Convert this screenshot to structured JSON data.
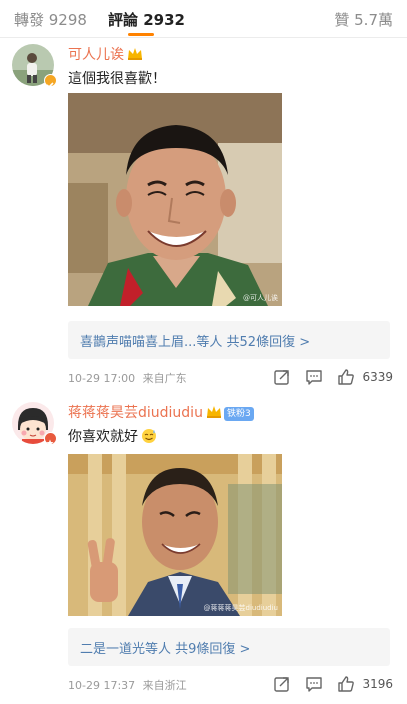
{
  "tabs": {
    "repost": "轉發 9298",
    "comments": "評論 2932",
    "likes": "贊 5.7萬"
  },
  "comments": [
    {
      "username": "可人儿诶",
      "text": "這個我很喜歡！",
      "watermark": "@可人儿诶",
      "replies": "喜鵲声喵喵喜上眉...等人 共52條回復 >",
      "time": "10-29 17:00",
      "location": "来自广东",
      "like_count": "6339"
    },
    {
      "username": "蒋蒋蒋昊芸diudiudiu",
      "fan_badge": "铁粉3",
      "text": "你喜欢就好",
      "watermark": "@蒋蒋蒋昊芸diudiudiu",
      "replies": "二是一道光等人 共9條回復 >",
      "time": "10-29 17:37",
      "location": "来自浙江",
      "like_count": "3196"
    }
  ],
  "icons": {
    "vip_crown": "crown-icon",
    "verified": "verified-badge-icon",
    "share": "share-icon",
    "comment": "comment-icon",
    "like": "thumbs-up-icon"
  },
  "colors": {
    "username": "#eb7350",
    "reply_link": "#507daf",
    "tab_underline": "#ff8200"
  }
}
